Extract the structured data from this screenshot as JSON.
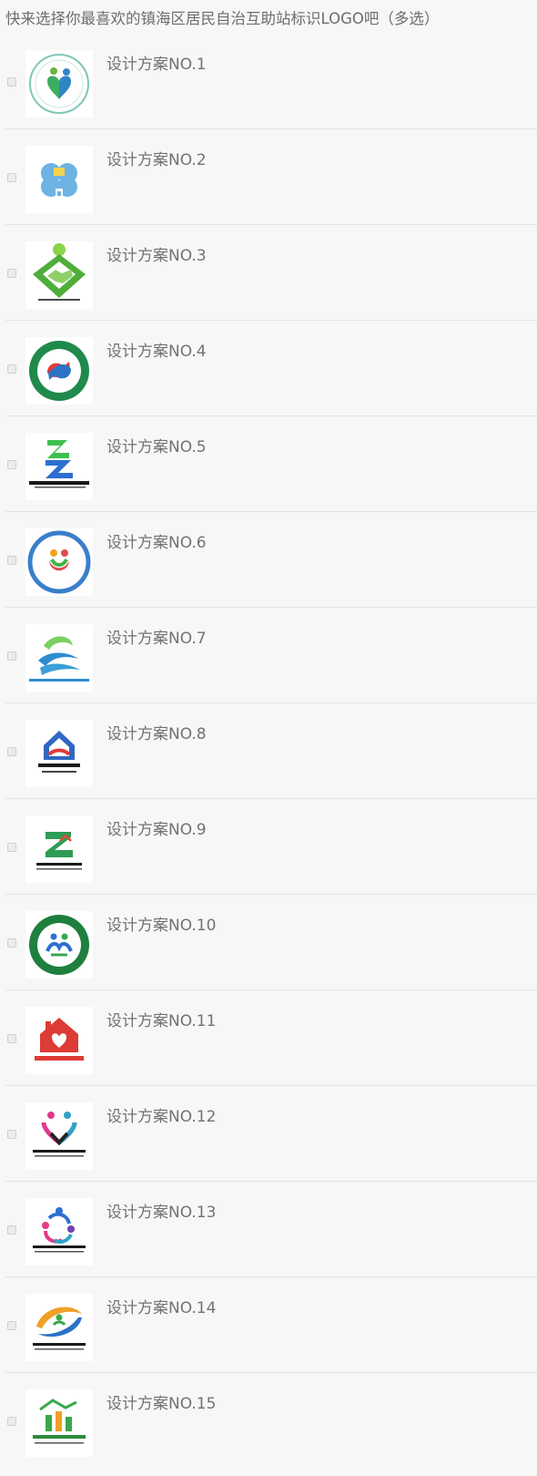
{
  "question": {
    "title": "快来选择你最喜欢的镇海区居民自治互助站标识LOGO吧（多选）"
  },
  "options": [
    {
      "label": "设计方案NO.1",
      "checked": false,
      "logo": "logo-1-green-circle-heart-icon"
    },
    {
      "label": "设计方案NO.2",
      "checked": false,
      "logo": "logo-2-blue-clover-icon"
    },
    {
      "label": "设计方案NO.3",
      "checked": false,
      "logo": "logo-3-green-handshake-icon"
    },
    {
      "label": "设计方案NO.4",
      "checked": false,
      "logo": "logo-4-green-ring-hands-icon"
    },
    {
      "label": "设计方案NO.5",
      "checked": false,
      "logo": "logo-5-blue-green-z-icon"
    },
    {
      "label": "设计方案NO.6",
      "checked": false,
      "logo": "logo-6-blue-ring-colorful-icon"
    },
    {
      "label": "设计方案NO.7",
      "checked": false,
      "logo": "logo-7-blue-green-wave-icon"
    },
    {
      "label": "设计方案NO.8",
      "checked": false,
      "logo": "logo-8-blue-house-hands-icon"
    },
    {
      "label": "设计方案NO.9",
      "checked": false,
      "logo": "logo-9-green-z-house-icon"
    },
    {
      "label": "设计方案NO.10",
      "checked": false,
      "logo": "logo-10-green-ring-people-icon"
    },
    {
      "label": "设计方案NO.11",
      "checked": false,
      "logo": "logo-11-red-house-heart-icon"
    },
    {
      "label": "设计方案NO.12",
      "checked": false,
      "logo": "logo-12-colorful-heart-people-icon"
    },
    {
      "label": "设计方案NO.13",
      "checked": false,
      "logo": "logo-13-colorful-swirl-people-icon"
    },
    {
      "label": "设计方案NO.14",
      "checked": false,
      "logo": "logo-14-orange-blue-swoosh-icon"
    },
    {
      "label": "设计方案NO.15",
      "checked": false,
      "logo": "logo-15-green-orange-bars-icon"
    }
  ],
  "colors": {
    "background": "#f7f7f7",
    "text": "#727272",
    "divider": "#e3e3e3"
  }
}
